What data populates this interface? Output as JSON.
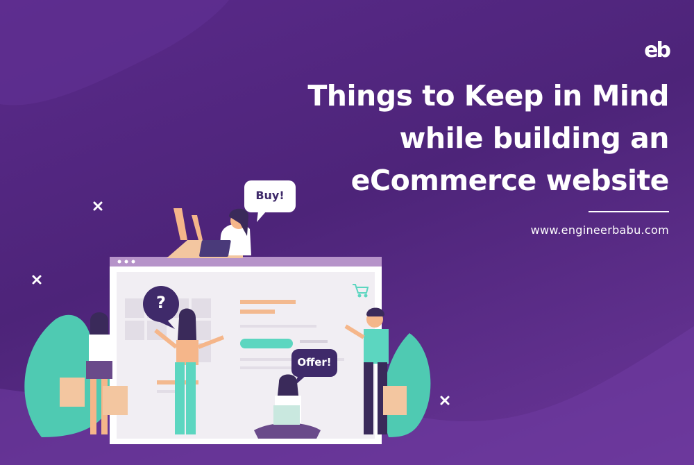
{
  "brand": {
    "logo_text": "eb"
  },
  "headline": {
    "line1": "Things to Keep in Mind",
    "line2": "while building an",
    "line3": "eCommerce website"
  },
  "website_url": "www.engineerbabu.com",
  "bubbles": {
    "buy": "Buy!",
    "question": "?",
    "offer": "Offer!"
  },
  "colors": {
    "background": "#4d2479",
    "accent_teal": "#5cd6c0",
    "skin": "#f5b68a",
    "bag": "#f3c6a0",
    "text": "#ffffff"
  },
  "icons": [
    "cart-icon",
    "close-x-icon"
  ]
}
